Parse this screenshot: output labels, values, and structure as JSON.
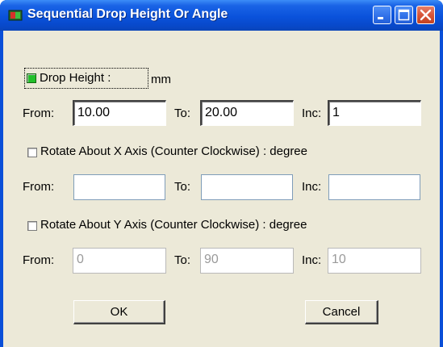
{
  "window": {
    "title": "Sequential Drop Height Or Angle",
    "title_bar_color": "#0a52db",
    "app_icon": "app-icon"
  },
  "drop_height": {
    "checked": true,
    "checkbox_color": "#22c02a",
    "label": "Drop Height :",
    "unit": "mm",
    "from_label": "From:",
    "from_value": "10.00",
    "to_label": "To:",
    "to_value": "20.00",
    "inc_label": "Inc:",
    "inc_value": "1"
  },
  "rotate_x": {
    "checked": false,
    "label": "Rotate About X Axis (Counter Clockwise) : degree",
    "from_label": "From:",
    "from_value": "",
    "to_label": "To:",
    "to_value": "",
    "inc_label": "Inc:",
    "inc_value": ""
  },
  "rotate_y": {
    "checked": false,
    "label": "Rotate About Y Axis (Counter Clockwise) : degree",
    "from_label": "From:",
    "from_value": "0",
    "to_label": "To:",
    "to_value": "90",
    "inc_label": "Inc:",
    "inc_value": "10"
  },
  "buttons": {
    "ok": "OK",
    "cancel": "Cancel"
  }
}
